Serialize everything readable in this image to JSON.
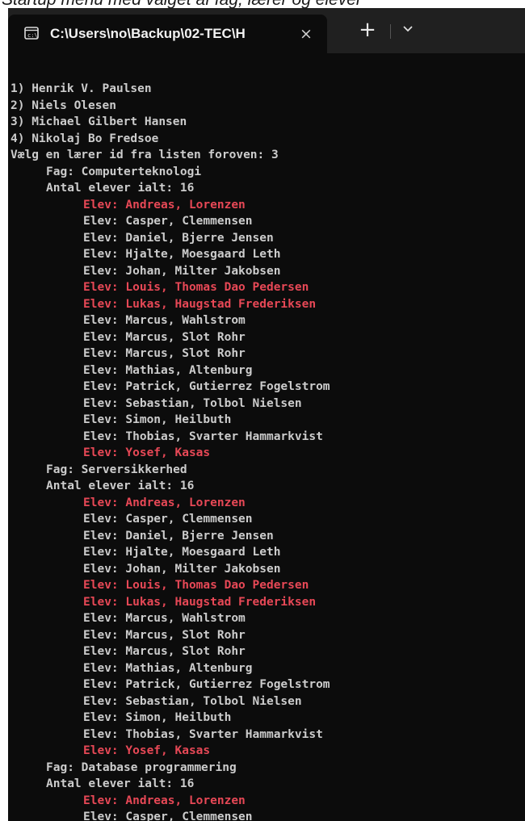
{
  "caption": "Startup menu med valget af fag, lærer og elever",
  "tab": {
    "title": "C:\\Users\\no\\Backup\\02-TEC\\H",
    "close_glyph": "×",
    "new_tab_glyph": "+",
    "icons": {
      "console": "terminal-icon",
      "dropdown": "chevron-down-icon"
    }
  },
  "colors": {
    "highlight": "#e74856",
    "text": "#cccccc",
    "background": "#0c0c0c"
  },
  "teachers": [
    "1) Henrik V. Paulsen",
    "2) Niels Olesen",
    "3) Michael Gilbert Hansen",
    "4) Nikolaj Bo Fredsoe"
  ],
  "prompt": "Vælg en lærer id fra listen foroven: 3",
  "courses": [
    {
      "fag": "Fag: Computerteknologi",
      "count": "Antal elever ialt: 16",
      "students": [
        {
          "text": "Elev: Andreas, Lorenzen",
          "red": true
        },
        {
          "text": "Elev: Casper, Clemmensen",
          "red": false
        },
        {
          "text": "Elev: Daniel, Bjerre Jensen",
          "red": false
        },
        {
          "text": "Elev: Hjalte, Moesgaard Leth",
          "red": false
        },
        {
          "text": "Elev: Johan, Milter Jakobsen",
          "red": false
        },
        {
          "text": "Elev: Louis, Thomas Dao Pedersen",
          "red": true
        },
        {
          "text": "Elev: Lukas, Haugstad Frederiksen",
          "red": true
        },
        {
          "text": "Elev: Marcus, Wahlstrom",
          "red": false
        },
        {
          "text": "Elev: Marcus, Slot Rohr",
          "red": false
        },
        {
          "text": "Elev: Marcus, Slot Rohr",
          "red": false
        },
        {
          "text": "Elev: Mathias, Altenburg",
          "red": false
        },
        {
          "text": "Elev: Patrick, Gutierrez Fogelstrom",
          "red": false
        },
        {
          "text": "Elev: Sebastian, Tolbol Nielsen",
          "red": false
        },
        {
          "text": "Elev: Simon, Heilbuth",
          "red": false
        },
        {
          "text": "Elev: Thobias, Svarter Hammarkvist",
          "red": false
        },
        {
          "text": "Elev: Yosef, Kasas",
          "red": true
        }
      ]
    },
    {
      "fag": "Fag: Serversikkerhed",
      "count": "Antal elever ialt: 16",
      "students": [
        {
          "text": "Elev: Andreas, Lorenzen",
          "red": true
        },
        {
          "text": "Elev: Casper, Clemmensen",
          "red": false
        },
        {
          "text": "Elev: Daniel, Bjerre Jensen",
          "red": false
        },
        {
          "text": "Elev: Hjalte, Moesgaard Leth",
          "red": false
        },
        {
          "text": "Elev: Johan, Milter Jakobsen",
          "red": false
        },
        {
          "text": "Elev: Louis, Thomas Dao Pedersen",
          "red": true
        },
        {
          "text": "Elev: Lukas, Haugstad Frederiksen",
          "red": true
        },
        {
          "text": "Elev: Marcus, Wahlstrom",
          "red": false
        },
        {
          "text": "Elev: Marcus, Slot Rohr",
          "red": false
        },
        {
          "text": "Elev: Marcus, Slot Rohr",
          "red": false
        },
        {
          "text": "Elev: Mathias, Altenburg",
          "red": false
        },
        {
          "text": "Elev: Patrick, Gutierrez Fogelstrom",
          "red": false
        },
        {
          "text": "Elev: Sebastian, Tolbol Nielsen",
          "red": false
        },
        {
          "text": "Elev: Simon, Heilbuth",
          "red": false
        },
        {
          "text": "Elev: Thobias, Svarter Hammarkvist",
          "red": false
        },
        {
          "text": "Elev: Yosef, Kasas",
          "red": true
        }
      ]
    },
    {
      "fag": "Fag: Database programmering",
      "count": "Antal elever ialt: 16",
      "students": [
        {
          "text": "Elev: Andreas, Lorenzen",
          "red": true
        },
        {
          "text": "Elev: Casper, Clemmensen",
          "red": false
        }
      ]
    }
  ]
}
